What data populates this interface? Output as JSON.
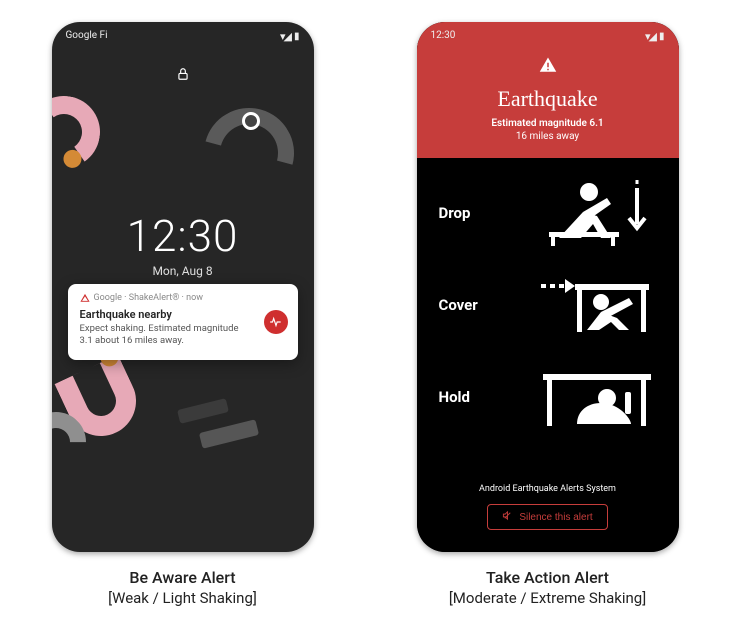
{
  "left": {
    "carrier": "Google Fi",
    "lock_time": "12:30",
    "lock_date": "Mon, Aug 8",
    "notif": {
      "source": "Google · ShakeAlert® · now",
      "title": "Earthquake nearby",
      "body": "Expect shaking. Estimated magnitude 3.1 about 16 miles away."
    },
    "caption_title": "Be Aware Alert",
    "caption_sub": "[Weak / Light Shaking]"
  },
  "right": {
    "status_time": "12:30",
    "eq_title": "Earthquake",
    "eq_sub": "Estimated magnitude 6.1",
    "eq_dist": "16 miles away",
    "steps": {
      "drop": "Drop",
      "cover": "Cover",
      "hold": "Hold"
    },
    "system": "Android Earthquake Alerts System",
    "silence": "Silence this alert",
    "caption_title": "Take Action Alert",
    "caption_sub": "[Moderate / Extreme Shaking]"
  }
}
